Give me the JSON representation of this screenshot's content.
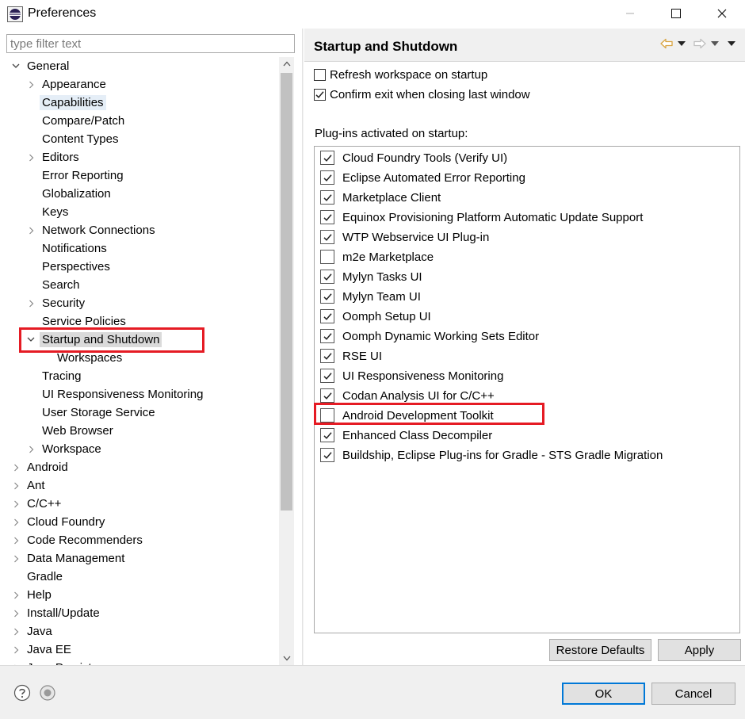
{
  "window": {
    "title": "Preferences",
    "controls": {
      "minimize": "—",
      "maximize": "☐",
      "close": "✕"
    }
  },
  "filter": {
    "placeholder": "type filter text",
    "value": ""
  },
  "tree": [
    {
      "label": "General",
      "depth": 0,
      "arrow": "expanded"
    },
    {
      "label": "Appearance",
      "depth": 1,
      "arrow": "collapsed"
    },
    {
      "label": "Capabilities",
      "depth": 1,
      "arrow": "none",
      "state": "highlight"
    },
    {
      "label": "Compare/Patch",
      "depth": 1,
      "arrow": "none"
    },
    {
      "label": "Content Types",
      "depth": 1,
      "arrow": "none"
    },
    {
      "label": "Editors",
      "depth": 1,
      "arrow": "collapsed"
    },
    {
      "label": "Error Reporting",
      "depth": 1,
      "arrow": "none"
    },
    {
      "label": "Globalization",
      "depth": 1,
      "arrow": "none"
    },
    {
      "label": "Keys",
      "depth": 1,
      "arrow": "none"
    },
    {
      "label": "Network Connections",
      "depth": 1,
      "arrow": "collapsed"
    },
    {
      "label": "Notifications",
      "depth": 1,
      "arrow": "none"
    },
    {
      "label": "Perspectives",
      "depth": 1,
      "arrow": "none"
    },
    {
      "label": "Search",
      "depth": 1,
      "arrow": "none"
    },
    {
      "label": "Security",
      "depth": 1,
      "arrow": "collapsed"
    },
    {
      "label": "Service Policies",
      "depth": 1,
      "arrow": "none"
    },
    {
      "label": "Startup and Shutdown",
      "depth": 1,
      "arrow": "expanded",
      "state": "selected"
    },
    {
      "label": "Workspaces",
      "depth": 2,
      "arrow": "none"
    },
    {
      "label": "Tracing",
      "depth": 1,
      "arrow": "none"
    },
    {
      "label": "UI Responsiveness Monitoring",
      "depth": 1,
      "arrow": "none"
    },
    {
      "label": "User Storage Service",
      "depth": 1,
      "arrow": "none"
    },
    {
      "label": "Web Browser",
      "depth": 1,
      "arrow": "none"
    },
    {
      "label": "Workspace",
      "depth": 1,
      "arrow": "collapsed"
    },
    {
      "label": "Android",
      "depth": 0,
      "arrow": "collapsed"
    },
    {
      "label": "Ant",
      "depth": 0,
      "arrow": "collapsed"
    },
    {
      "label": "C/C++",
      "depth": 0,
      "arrow": "collapsed"
    },
    {
      "label": "Cloud Foundry",
      "depth": 0,
      "arrow": "collapsed"
    },
    {
      "label": "Code Recommenders",
      "depth": 0,
      "arrow": "collapsed"
    },
    {
      "label": "Data Management",
      "depth": 0,
      "arrow": "collapsed"
    },
    {
      "label": "Gradle",
      "depth": 0,
      "arrow": "none"
    },
    {
      "label": "Help",
      "depth": 0,
      "arrow": "collapsed"
    },
    {
      "label": "Install/Update",
      "depth": 0,
      "arrow": "collapsed"
    },
    {
      "label": "Java",
      "depth": 0,
      "arrow": "collapsed"
    },
    {
      "label": "Java EE",
      "depth": 0,
      "arrow": "collapsed"
    },
    {
      "label": "Java Persistence",
      "depth": 0,
      "arrow": "collapsed"
    }
  ],
  "page": {
    "title": "Startup and Shutdown",
    "options": [
      {
        "label": "Refresh workspace on startup",
        "checked": false
      },
      {
        "label": "Confirm exit when closing last window",
        "checked": true
      }
    ],
    "plugins_label": "Plug-ins activated on startup:",
    "plugins": [
      {
        "label": "Cloud Foundry Tools (Verify UI)",
        "checked": true
      },
      {
        "label": "Eclipse Automated Error Reporting",
        "checked": true
      },
      {
        "label": "Marketplace Client",
        "checked": true
      },
      {
        "label": "Equinox Provisioning Platform Automatic Update Support",
        "checked": true
      },
      {
        "label": "WTP Webservice UI Plug-in",
        "checked": true
      },
      {
        "label": "m2e Marketplace",
        "checked": false
      },
      {
        "label": "Mylyn Tasks UI",
        "checked": true
      },
      {
        "label": "Mylyn Team UI",
        "checked": true
      },
      {
        "label": "Oomph Setup UI",
        "checked": true
      },
      {
        "label": "Oomph Dynamic Working Sets Editor",
        "checked": true
      },
      {
        "label": "RSE UI",
        "checked": true
      },
      {
        "label": "UI Responsiveness Monitoring",
        "checked": true
      },
      {
        "label": "Codan Analysis UI for C/C++",
        "checked": true
      },
      {
        "label": "Android Development Toolkit",
        "checked": false
      },
      {
        "label": "Enhanced Class Decompiler",
        "checked": true
      },
      {
        "label": "Buildship, Eclipse Plug-ins for Gradle - STS Gradle Migration",
        "checked": true
      }
    ],
    "restore_defaults": "Restore Defaults",
    "apply": "Apply"
  },
  "dialog": {
    "ok": "OK",
    "cancel": "Cancel"
  },
  "colors": {
    "annotation": "#e51b24",
    "selection": "#dadada",
    "highlight": "#e5eef7",
    "accent": "#0078d7",
    "nav_arrow": "#d9a441"
  }
}
